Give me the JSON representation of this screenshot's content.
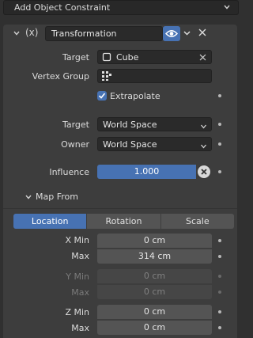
{
  "add_constraint": {
    "label": "Add Object Constraint"
  },
  "header": {
    "fx_icon": "(x)",
    "name": "Transformation"
  },
  "target": {
    "label": "Target",
    "value": "Cube"
  },
  "vertex_group": {
    "label": "Vertex Group",
    "value": ""
  },
  "extrapolate": {
    "label": "Extrapolate",
    "checked": true
  },
  "target_space": {
    "label": "Target",
    "value": "World Space"
  },
  "owner_space": {
    "label": "Owner",
    "value": "World Space"
  },
  "influence": {
    "label": "Influence",
    "value": "1.000"
  },
  "map_from": {
    "label": "Map From"
  },
  "tabs": [
    {
      "label": "Location",
      "active": true
    },
    {
      "label": "Rotation",
      "active": false
    },
    {
      "label": "Scale",
      "active": false
    }
  ],
  "ranges": {
    "x_min": {
      "label": "X Min",
      "value": "0 cm"
    },
    "x_max": {
      "label": "Max",
      "value": "314 cm"
    },
    "y_min": {
      "label": "Y Min",
      "value": "0 cm"
    },
    "y_max": {
      "label": "Max",
      "value": "0 cm"
    },
    "z_min": {
      "label": "Z Min",
      "value": "0 cm"
    },
    "z_max": {
      "label": "Max",
      "value": "0 cm"
    }
  },
  "colors": {
    "accent": "#4772b3",
    "panel": "#3d3d3d",
    "background": "#303030"
  }
}
